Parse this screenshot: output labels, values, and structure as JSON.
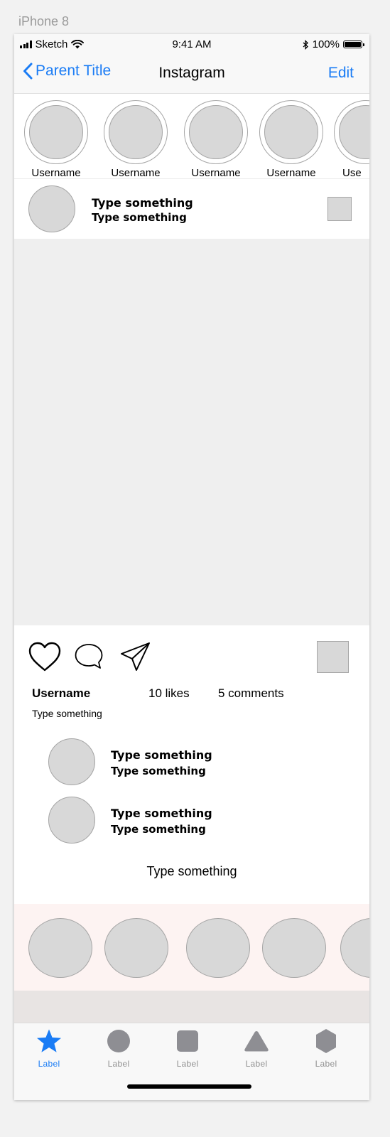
{
  "artboard": {
    "label": "iPhone 8"
  },
  "status_bar": {
    "carrier": "Sketch",
    "time": "9:41 AM",
    "battery": "100%",
    "icons": [
      "signal-icon",
      "wifi-icon",
      "bluetooth-icon",
      "battery-icon"
    ]
  },
  "nav": {
    "back_label": "Parent Title",
    "title": "Instagram",
    "edit_label": "Edit"
  },
  "stories": [
    {
      "username": "Username"
    },
    {
      "username": "Username"
    },
    {
      "username": "Username"
    },
    {
      "username": "Username"
    },
    {
      "username": "Use"
    }
  ],
  "post": {
    "header_line1": "Type something",
    "header_line2": "Type something",
    "username": "Username",
    "likes": "10 likes",
    "comments_count": "5 comments",
    "caption": "Type something",
    "comments": [
      {
        "line1": "Type something",
        "line2": "Type something"
      },
      {
        "line1": "Type something",
        "line2": "Type something"
      }
    ],
    "view_more": "Type something"
  },
  "tabs": [
    {
      "label": "Label",
      "icon": "star-icon",
      "active": true
    },
    {
      "label": "Label",
      "icon": "circle-icon",
      "active": false
    },
    {
      "label": "Label",
      "icon": "square-icon",
      "active": false
    },
    {
      "label": "Label",
      "icon": "triangle-icon",
      "active": false
    },
    {
      "label": "Label",
      "icon": "hexagon-icon",
      "active": false
    }
  ],
  "colors": {
    "accent": "#1a7cf5",
    "placeholder": "#d8d8d8",
    "placeholder_border": "#a5a5a5",
    "image_area": "#efefef",
    "highlights_bg": "#fdf3f2",
    "tab_inactive": "#929292"
  }
}
